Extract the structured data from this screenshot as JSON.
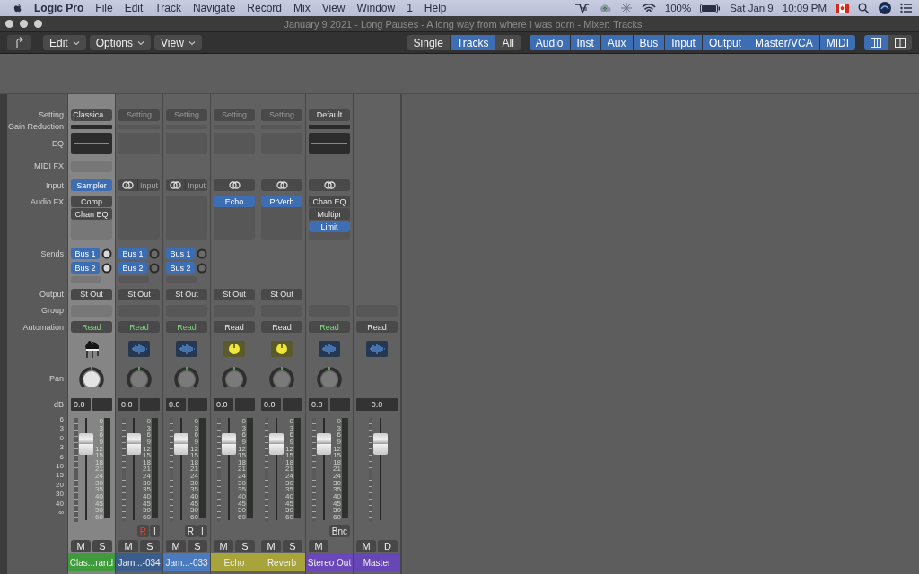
{
  "menubar": {
    "app": "Logic Pro",
    "menus": [
      "File",
      "Edit",
      "Track",
      "Navigate",
      "Record",
      "Mix",
      "View",
      "Window",
      "1",
      "Help"
    ],
    "battery": "100%",
    "date": "Sat Jan 9",
    "time": "10:09 PM"
  },
  "window": {
    "title": "January 9 2021 - Long Pauses - A long way from where I was born - Mixer: Tracks"
  },
  "toolbar": {
    "menus": [
      "Edit",
      "Options",
      "View"
    ],
    "scope": [
      {
        "label": "Single",
        "selected": false
      },
      {
        "label": "Tracks",
        "selected": true
      },
      {
        "label": "All",
        "selected": false
      }
    ],
    "filters": [
      {
        "label": "Audio",
        "selected": true
      },
      {
        "label": "Inst",
        "selected": true
      },
      {
        "label": "Aux",
        "selected": true
      },
      {
        "label": "Bus",
        "selected": true
      },
      {
        "label": "Input",
        "selected": true
      },
      {
        "label": "Output",
        "selected": true
      },
      {
        "label": "Master/VCA",
        "selected": true
      },
      {
        "label": "MIDI",
        "selected": true
      }
    ],
    "views": [
      {
        "kind": "columns",
        "selected": true
      },
      {
        "kind": "split",
        "selected": false
      }
    ]
  },
  "mixer": {
    "labels": [
      "Setting",
      "Gain Reduction",
      "EQ",
      "MIDI FX",
      "Input",
      "Audio FX",
      "Sends",
      "Output",
      "Group",
      "Automation",
      "Pan",
      "dB"
    ],
    "fader_scale": [
      "6",
      "3",
      "0",
      "3",
      "6",
      "10",
      "15",
      "20",
      "30",
      "40",
      "∞"
    ],
    "strips": [
      {
        "selected": true,
        "setting": {
          "label": "Classica...",
          "empty": false
        },
        "gain_reduction": {
          "active": true
        },
        "eq": {
          "active": true
        },
        "midi_fx": true,
        "input": {
          "kind": "plugin",
          "label": "Sampler"
        },
        "audio_fx_panel": true,
        "audio_fx": [
          {
            "name": "Comp",
            "selected": false
          },
          {
            "name": "Chan EQ",
            "selected": false
          }
        ],
        "sends": [
          {
            "name": "Bus 1"
          },
          {
            "name": "Bus 2"
          }
        ],
        "output": "St Out",
        "group": true,
        "automation": {
          "label": "Read",
          "active": true
        },
        "icon": {
          "kind": "piano"
        },
        "pan": true,
        "db": {
          "volume": "0.0",
          "peak": true
        },
        "fader": {
          "level": 0.75
        },
        "meter_scale": [
          "0",
          "3",
          "6",
          "9",
          "12",
          "15",
          "18",
          "21",
          "24",
          "30",
          "35",
          "40",
          "45",
          "50",
          "60"
        ],
        "buttons": [
          "M",
          "S"
        ],
        "name": "Clas...rand",
        "color": "#3f9b3b"
      },
      {
        "selected": false,
        "setting": {
          "label": "Setting",
          "empty": true
        },
        "gain_reduction": {
          "active": false
        },
        "eq": {
          "active": false
        },
        "input": {
          "kind": "link_input",
          "label": "Input"
        },
        "audio_fx_panel": true,
        "sends": [
          {
            "name": "Bus 1"
          },
          {
            "name": "Bus 2"
          }
        ],
        "output": "St Out",
        "group": true,
        "automation": {
          "label": "Read",
          "active": true
        },
        "icon": {
          "kind": "waveform"
        },
        "pan": true,
        "db": {
          "volume": "0.0",
          "peak": true
        },
        "fader": {
          "level": 0.75
        },
        "meter_scale": [
          "0",
          "3",
          "6",
          "9",
          "12",
          "15",
          "18",
          "21",
          "24",
          "30",
          "35",
          "40",
          "45",
          "50",
          "60"
        ],
        "extra_buttons": [
          {
            "label": "R",
            "on": true
          },
          {
            "label": "I",
            "on": false
          }
        ],
        "buttons": [
          "M",
          "S"
        ],
        "name": "Jam...-034",
        "color": "#3b5d8e"
      },
      {
        "selected": false,
        "setting": {
          "label": "Setting",
          "empty": true
        },
        "gain_reduction": {
          "active": false
        },
        "eq": {
          "active": false
        },
        "input": {
          "kind": "link_input",
          "label": "Input"
        },
        "audio_fx_panel": true,
        "sends": [
          {
            "name": "Bus 1"
          },
          {
            "name": "Bus 2"
          }
        ],
        "output": "St Out",
        "group": true,
        "automation": {
          "label": "Read",
          "active": true
        },
        "icon": {
          "kind": "waveform"
        },
        "pan": true,
        "db": {
          "volume": "0.0",
          "peak": true
        },
        "fader": {
          "level": 0.75
        },
        "meter_scale": [
          "0",
          "3",
          "6",
          "9",
          "12",
          "15",
          "18",
          "21",
          "24",
          "30",
          "35",
          "40",
          "45",
          "50",
          "60"
        ],
        "extra_buttons": [
          {
            "label": "R",
            "on": false
          },
          {
            "label": "I",
            "on": false
          }
        ],
        "buttons": [
          "M",
          "S"
        ],
        "name": "Jam...-033",
        "color": "#4a7bc0"
      },
      {
        "selected": false,
        "setting": {
          "label": "Setting",
          "empty": true
        },
        "gain_reduction": {
          "active": false
        },
        "eq": {
          "active": false
        },
        "input": {
          "kind": "link"
        },
        "audio_fx_panel": true,
        "audio_fx": [
          {
            "name": "Echo",
            "selected": true
          }
        ],
        "output": "St Out",
        "group": true,
        "automation": {
          "label": "Read",
          "active": false
        },
        "icon": {
          "kind": "dial"
        },
        "pan": true,
        "db": {
          "volume": "0.0",
          "peak": true
        },
        "fader": {
          "level": 0.75
        },
        "meter_scale": [
          "0",
          "3",
          "6",
          "9",
          "12",
          "15",
          "18",
          "21",
          "24",
          "30",
          "35",
          "40",
          "45",
          "50",
          "60"
        ],
        "buttons": [
          "M",
          "S"
        ],
        "name": "Echo",
        "color": "#a7a43b"
      },
      {
        "selected": false,
        "setting": {
          "label": "Setting",
          "empty": true
        },
        "gain_reduction": {
          "active": false
        },
        "eq": {
          "active": false
        },
        "input": {
          "kind": "link"
        },
        "audio_fx_panel": true,
        "audio_fx": [
          {
            "name": "PtVerb",
            "selected": true
          }
        ],
        "output": "St Out",
        "group": true,
        "automation": {
          "label": "Read",
          "active": false
        },
        "icon": {
          "kind": "dial"
        },
        "pan": true,
        "db": {
          "volume": "0.0",
          "peak": true
        },
        "fader": {
          "level": 0.75
        },
        "meter_scale": [
          "0",
          "3",
          "6",
          "9",
          "12",
          "15",
          "18",
          "21",
          "24",
          "30",
          "35",
          "40",
          "45",
          "50",
          "60"
        ],
        "buttons": [
          "M",
          "S"
        ],
        "name": "Reverb",
        "color": "#a7a43b"
      },
      {
        "selected": false,
        "setting": {
          "label": "Default",
          "empty": false
        },
        "gain_reduction": {
          "active": true
        },
        "eq": {
          "active": true
        },
        "input": {
          "kind": "link"
        },
        "audio_fx_panel": true,
        "audio_fx": [
          {
            "name": "Chan EQ",
            "selected": false
          },
          {
            "name": "Multipr",
            "selected": false
          },
          {
            "name": "Limit",
            "selected": true
          }
        ],
        "group": true,
        "automation": {
          "label": "Read",
          "active": true
        },
        "icon": {
          "kind": "waveform"
        },
        "pan": true,
        "db": {
          "volume": "0.0",
          "peak": true
        },
        "fader": {
          "level": 0.75
        },
        "meter_scale": [
          "0",
          "3",
          "6",
          "9",
          "12",
          "15",
          "18",
          "21",
          "24",
          "30",
          "35",
          "40",
          "45",
          "50",
          "60"
        ],
        "extra_buttons": [
          {
            "label": "Bnc",
            "on": false
          }
        ],
        "buttons": [
          "M"
        ],
        "name": "Stereo Out",
        "color": "#6a48b9"
      },
      {
        "selected": false,
        "group": true,
        "automation": {
          "label": "Read",
          "active": false
        },
        "icon": {
          "kind": "waveform"
        },
        "db": {
          "volume": "0.0",
          "peak": false
        },
        "fader": {
          "level": 0.75
        },
        "buttons": [
          "M",
          "D"
        ],
        "name": "Master",
        "color": "#6746b5"
      }
    ]
  }
}
